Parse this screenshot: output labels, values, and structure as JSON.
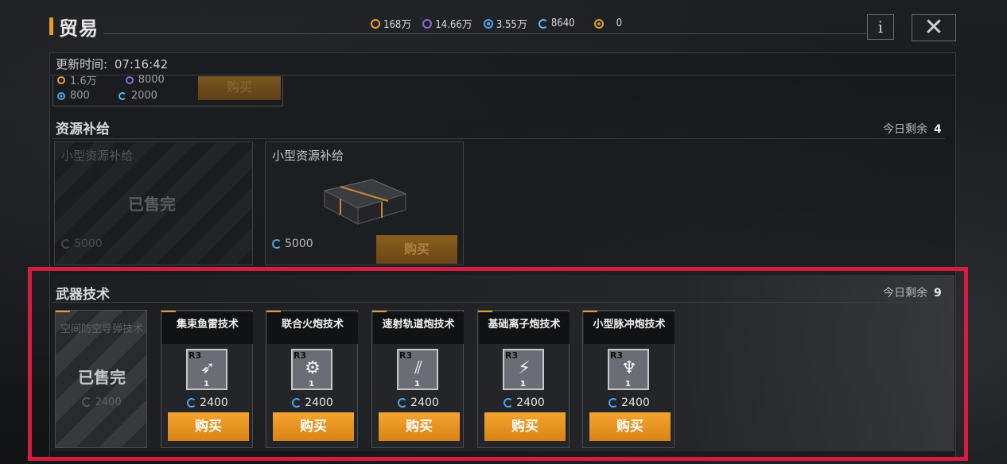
{
  "header": {
    "title": "贸易",
    "currencies": [
      {
        "icon": "gold-coin-icon",
        "value": "168万",
        "color": "#e0a532"
      },
      {
        "icon": "purple-crystal-icon",
        "value": "14.66万",
        "color": "#8a6ad8"
      },
      {
        "icon": "blue-energy-icon",
        "value": "3.55万",
        "color": "#4aa4e8"
      },
      {
        "icon": "g-credit-icon",
        "value": "8640",
        "color": "#58b8ea"
      },
      {
        "icon": "orange-token-icon",
        "value": "0",
        "color": "#e0a532"
      }
    ],
    "info_label": "i",
    "close_label": "✕"
  },
  "update": {
    "label": "更新时间:",
    "time": "07:16:42"
  },
  "top_card": {
    "prices": [
      "1.6万",
      "8000",
      "800",
      "2000"
    ],
    "buy_label": "购买"
  },
  "resource_section": {
    "title": "资源补给",
    "remain_label": "今日剩余",
    "remain_count": "4",
    "items": [
      {
        "name": "小型资源补给",
        "status": "已售完",
        "price": "5000"
      },
      {
        "name": "小型资源补给",
        "price": "5000",
        "buy_label": "购买"
      }
    ]
  },
  "weapon_section": {
    "title": "武器技术",
    "remain_label": "今日剩余",
    "remain_count": "9",
    "sold_item": {
      "name": "空间防空导弹技术",
      "status": "已售完",
      "price": "2400"
    },
    "items": [
      {
        "name": "集束鱼雷技术",
        "rank": "R3",
        "qty": "1",
        "price": "2400",
        "buy_label": "购买",
        "icon": "torpedo-icon"
      },
      {
        "name": "联合火炮技术",
        "rank": "R3",
        "qty": "1",
        "price": "2400",
        "buy_label": "购买",
        "icon": "cannon-icon"
      },
      {
        "name": "速射轨道炮技术",
        "rank": "R3",
        "qty": "1",
        "price": "2400",
        "buy_label": "购买",
        "icon": "railgun-icon"
      },
      {
        "name": "基础离子炮技术",
        "rank": "R3",
        "qty": "1",
        "price": "2400",
        "buy_label": "购买",
        "icon": "ion-cannon-icon"
      },
      {
        "name": "小型脉冲炮技术",
        "rank": "R3",
        "qty": "1",
        "price": "2400",
        "buy_label": "购买",
        "icon": "pulse-cannon-icon"
      }
    ]
  }
}
